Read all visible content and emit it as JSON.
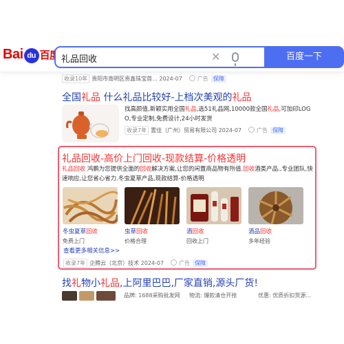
{
  "search": {
    "logo_bai": "Bai",
    "logo_du": "du",
    "logo_cn": "百度",
    "query": "礼品回收",
    "button_label": "百度一下"
  },
  "result1": {
    "tag": "收录10年",
    "source": "贵阳市南明区贵鑫珠宝首... 2024-07",
    "ad_label": "广告",
    "insured": "保障"
  },
  "result2": {
    "title_parts": [
      "全国",
      "礼品",
      " 什么礼品比较好-上档次美观的",
      "礼品"
    ],
    "desc_line1_parts": [
      "找高颜值,新颖实用全国",
      "礼品",
      ",选51礼品网,10000款全国",
      "礼品",
      ",可加印LOG"
    ],
    "desc_line2": "O,专业定制,免费设计,24小时发货",
    "tag": "收录7年",
    "source": "置佳（广州）贸易有限公司 2024-07",
    "ad_label": "广告",
    "insured": "保障"
  },
  "result3": {
    "title": "礼品回收-高价上门回收-现款结算-价格透明",
    "desc_line1_parts": [
      "礼品回收",
      " 鸿鹏为您提供全面的",
      "回收",
      "解决方案,让您的闲置商品物有所值.",
      "回收",
      "酒类产品.,专业团队,快"
    ],
    "desc_line2": "速响应,让您省心省力.冬虫夏草产品,现款结算-价格透明",
    "gallery": [
      {
        "caption": "冬虫夏草",
        "caption_kw": "回收",
        "sub": "免费上门"
      },
      {
        "caption": "虫草",
        "caption_kw": "回收",
        "sub": "价格合理"
      },
      {
        "caption": "酒",
        "caption_kw": "回收",
        "sub": "回收上门"
      },
      {
        "caption": "酒品",
        "caption_kw": "回收",
        "sub": "多年经验"
      }
    ],
    "more_link": "查看更多相关信息>>",
    "tag": "收录7年",
    "source": "企腾云（北京）技术 2024-07",
    "ad_label": "广告",
    "insured": "保障"
  },
  "result4": {
    "title_parts": [
      "找",
      "礼",
      "物小",
      "礼品",
      ",上阿里巴巴,厂家直销,源头厂货!"
    ],
    "info": [
      "品牌: 1688采购批发网",
      "物流: 爆款清仓开抢",
      "优惠: 优质折扣货源..."
    ]
  },
  "colors": {
    "accent": "#4e6ef2",
    "link": "#2440b3",
    "keyword": "#f73131",
    "card_border": "#f05a6e"
  }
}
